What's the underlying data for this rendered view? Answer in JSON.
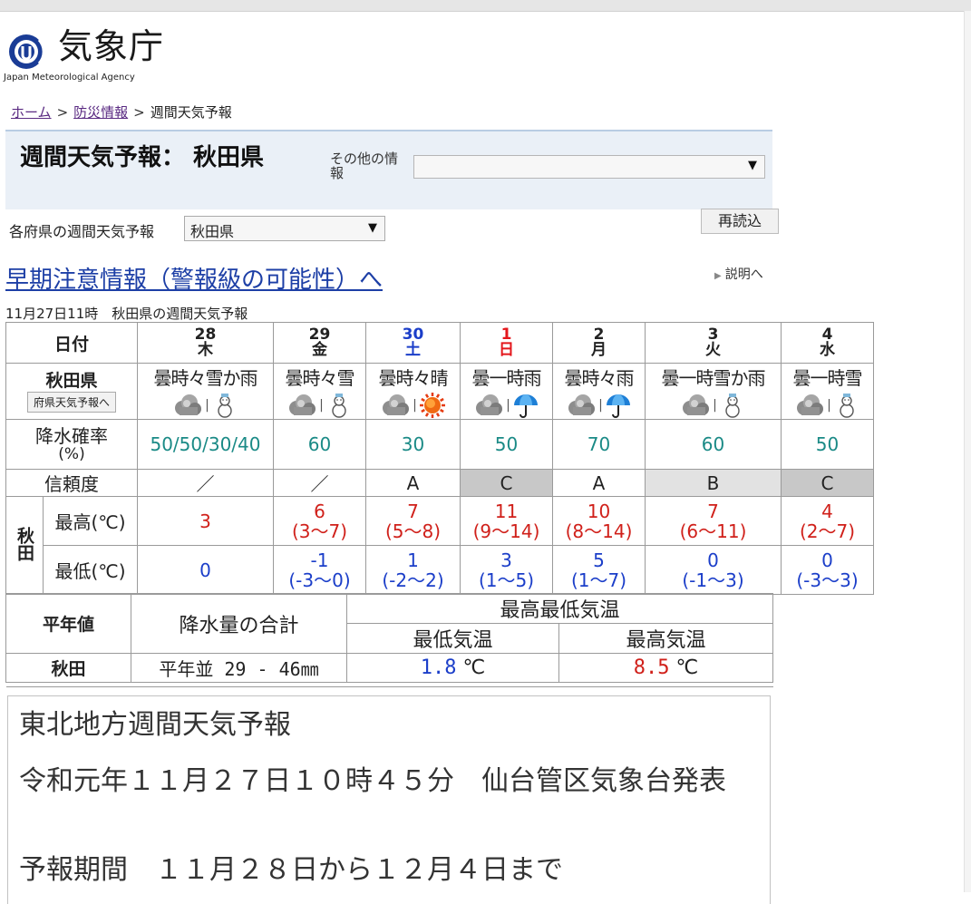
{
  "agency": {
    "name": "気象庁",
    "name_en": "Japan Meteorological Agency"
  },
  "breadcrumb": {
    "home": "ホーム",
    "sep1": ">",
    "disaster": "防災情報",
    "sep2": ">",
    "current": "週間天気予報"
  },
  "header": {
    "title": "週間天気予報： 秋田県",
    "other_info_label": "その他の情報",
    "other_info_arrow": "▼",
    "prefecture_label": "各府県の週間天気予報",
    "prefecture_value": "秋田県",
    "prefecture_arrow": "▼",
    "reload": "再読込"
  },
  "early_warning_link": "早期注意情報（警報級の可能性）へ",
  "explain_link": "説明へ",
  "caption": "11月27日11時　秋田県の週間天気予報",
  "table": {
    "date_header": "日付",
    "region": "秋田県",
    "region_link": "府県天気予報へ",
    "pop_header_1": "降水確率",
    "pop_header_2": "(%)",
    "reliability_header": "信頼度",
    "city_vertical": "秋田",
    "max_header": "最高(℃)",
    "min_header": "最低(℃)",
    "days": [
      {
        "day": "28",
        "weekday": "木",
        "type": "weekday",
        "condition": "曇時々雪か雨",
        "icon2": "snowman",
        "pop": "50/50/30/40",
        "reliability": "／",
        "rel_bg": "none",
        "max": "3",
        "max_range": "",
        "min": "0",
        "min_range": ""
      },
      {
        "day": "29",
        "weekday": "金",
        "type": "weekday",
        "condition": "曇時々雪",
        "icon2": "snowman",
        "pop": "60",
        "reliability": "／",
        "rel_bg": "none",
        "max": "6",
        "max_range": "(3〜7)",
        "min": "-1",
        "min_range": "(-3〜0)"
      },
      {
        "day": "30",
        "weekday": "土",
        "type": "saturday",
        "condition": "曇時々晴",
        "icon2": "sun",
        "pop": "30",
        "reliability": "A",
        "rel_bg": "none",
        "max": "7",
        "max_range": "(5〜8)",
        "min": "1",
        "min_range": "(-2〜2)"
      },
      {
        "day": "1",
        "weekday": "日",
        "type": "sunday",
        "condition": "曇一時雨",
        "icon2": "umbrella",
        "pop": "50",
        "reliability": "C",
        "rel_bg": "gray",
        "max": "11",
        "max_range": "(9〜14)",
        "min": "3",
        "min_range": "(1〜5)"
      },
      {
        "day": "2",
        "weekday": "月",
        "type": "weekday",
        "condition": "曇時々雨",
        "icon2": "umbrella",
        "pop": "70",
        "reliability": "A",
        "rel_bg": "none",
        "max": "10",
        "max_range": "(8〜14)",
        "min": "5",
        "min_range": "(1〜7)"
      },
      {
        "day": "3",
        "weekday": "火",
        "type": "weekday",
        "condition": "曇一時雪か雨",
        "icon2": "snowman",
        "pop": "60",
        "reliability": "B",
        "rel_bg": "lgray",
        "max": "7",
        "max_range": "(6〜11)",
        "min": "0",
        "min_range": "(-1〜3)"
      },
      {
        "day": "4",
        "weekday": "水",
        "type": "weekday",
        "condition": "曇一時雪",
        "icon2": "snowman",
        "pop": "50",
        "reliability": "C",
        "rel_bg": "gray",
        "max": "4",
        "max_range": "(2〜7)",
        "min": "0",
        "min_range": "(-3〜3)"
      }
    ]
  },
  "normals": {
    "header": "平年値",
    "precip_header": "降水量の合計",
    "temp_header": "最高最低気温",
    "min_temp_header": "最低気温",
    "max_temp_header": "最高気温",
    "city": "秋田",
    "precip_value": "平年並 29 - 46㎜",
    "min_temp": "1.8",
    "max_temp": "8.5",
    "unit": "℃"
  },
  "text_forecast": {
    "title": "東北地方週間天気予報",
    "issued": "令和元年１１月２７日１０時４５分　仙台管区気象台発表",
    "period": "予報期間　１１月２８日から１２月４日まで"
  },
  "colors": {
    "sunday": "#e4171c",
    "saturday": "#1b3ec9",
    "max_temp": "#d0201a",
    "min_temp": "#1b3ec9",
    "pop": "#1a8a86",
    "link": "#1d3fa6"
  }
}
